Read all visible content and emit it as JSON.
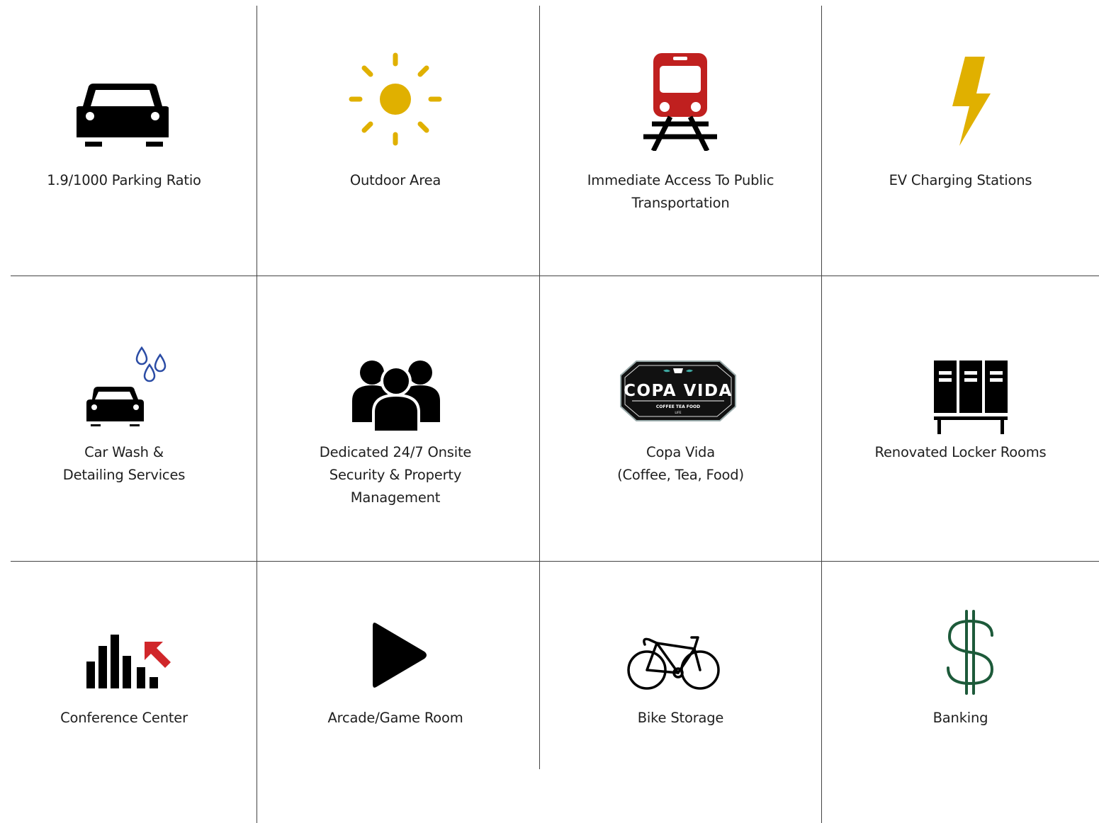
{
  "amenities": [
    {
      "lines": [
        "1.9/1000 Parking Ratio"
      ],
      "icon": "car-icon"
    },
    {
      "lines": [
        "Outdoor Area"
      ],
      "icon": "sun-icon",
      "color": "#E0B000"
    },
    {
      "lines": [
        "Immediate Access To Public",
        "Transportation"
      ],
      "icon": "train-icon",
      "color": "#C0201F"
    },
    {
      "lines": [
        "EV Charging Stations"
      ],
      "icon": "lightning-bolt-icon",
      "color": "#E0B000"
    },
    {
      "lines": [
        "Car Wash &",
        "Detailing Services"
      ],
      "icon": "car-wash-icon",
      "color": "#2B4CA5"
    },
    {
      "lines": [
        "Dedicated 24/7 Onsite",
        "Security & Property",
        "Management"
      ],
      "icon": "people-group-icon"
    },
    {
      "lines": [
        "Copa Vida",
        "(Coffee, Tea, Food)"
      ],
      "icon": "copa-vida-logo",
      "logo": {
        "top": "COPA VIDA",
        "bottom": "COFFEE  TEA  FOOD",
        "sub": "LIFE"
      }
    },
    {
      "lines": [
        "Renovated Locker Rooms"
      ],
      "icon": "locker-icon"
    },
    {
      "lines": [
        "Conference Center"
      ],
      "icon": "bar-chart-arrow-icon",
      "color": "#D0262A"
    },
    {
      "lines": [
        "Arcade/Game Room"
      ],
      "icon": "play-icon"
    },
    {
      "lines": [
        "Bike Storage"
      ],
      "icon": "bicycle-icon"
    },
    {
      "lines": [
        "Banking"
      ],
      "icon": "dollar-sign-icon",
      "color": "#1D5A3A"
    }
  ]
}
